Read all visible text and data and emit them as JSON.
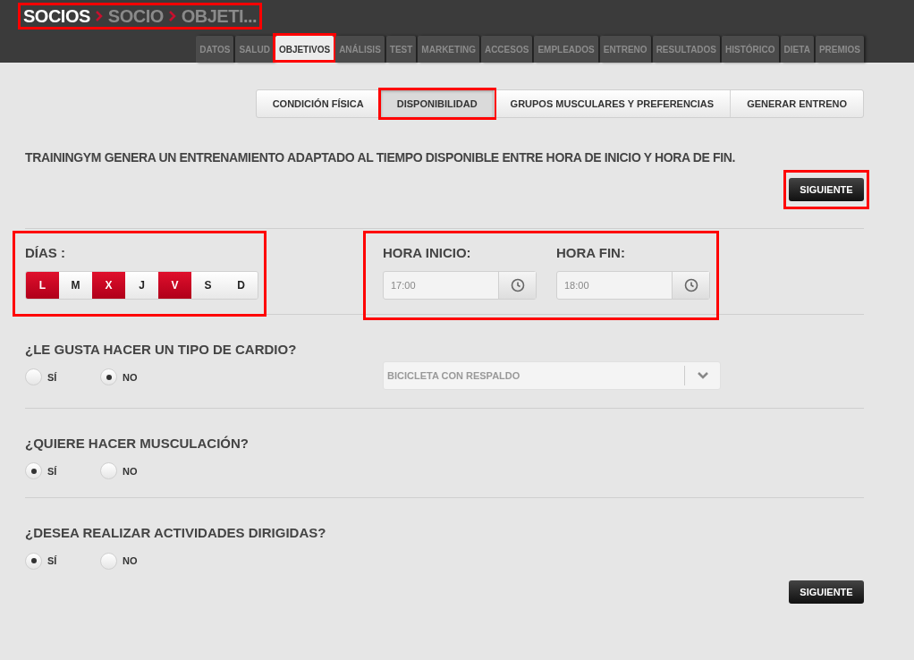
{
  "breadcrumb": {
    "highlight": true,
    "items": [
      {
        "label": "SOCIOS",
        "current": false
      },
      {
        "label": "SOCIO",
        "current": true
      },
      {
        "label": "OBJETI...",
        "current": true
      }
    ]
  },
  "tabs": [
    {
      "label": "DATOS",
      "selected": false,
      "highlight": false
    },
    {
      "label": "SALUD",
      "selected": false,
      "highlight": false
    },
    {
      "label": "OBJETIVOS",
      "selected": true,
      "highlight": true
    },
    {
      "label": "ANÁLISIS",
      "selected": false,
      "highlight": false
    },
    {
      "label": "TEST",
      "selected": false,
      "highlight": false
    },
    {
      "label": "MARKETING",
      "selected": false,
      "highlight": false
    },
    {
      "label": "ACCESOS",
      "selected": false,
      "highlight": false
    },
    {
      "label": "EMPLEADOS",
      "selected": false,
      "highlight": false
    },
    {
      "label": "ENTRENO",
      "selected": false,
      "highlight": false
    },
    {
      "label": "RESULTADOS",
      "selected": false,
      "highlight": false
    },
    {
      "label": "HISTÓRICO",
      "selected": false,
      "highlight": false
    },
    {
      "label": "DIETA",
      "selected": false,
      "highlight": false
    },
    {
      "label": "PREMIOS",
      "selected": false,
      "highlight": false
    }
  ],
  "subtabs": [
    {
      "label": "CONDICIÓN FÍSICA",
      "selected": false,
      "highlight": false
    },
    {
      "label": "DISPONIBILIDAD",
      "selected": true,
      "highlight": true
    },
    {
      "label": "GRUPOS MUSCULARES Y PREFERENCIAS",
      "selected": false,
      "highlight": false
    },
    {
      "label": "GENERAR ENTRENO",
      "selected": false,
      "highlight": false
    }
  ],
  "intro": "TRAININGYM GENERA UN ENTRENAMIENTO ADAPTADO AL TIEMPO DISPONIBLE ENTRE HORA DE INICIO Y HORA DE FIN.",
  "next_top": {
    "label": "SIGUIENTE",
    "highlight": true
  },
  "days": {
    "label": "DÍAS :",
    "highlight": true,
    "items": [
      {
        "label": "L",
        "selected": true
      },
      {
        "label": "M",
        "selected": false
      },
      {
        "label": "X",
        "selected": true
      },
      {
        "label": "J",
        "selected": false
      },
      {
        "label": "V",
        "selected": true
      },
      {
        "label": "S",
        "selected": false
      },
      {
        "label": "D",
        "selected": false
      }
    ]
  },
  "hours": {
    "highlight": true,
    "fields": [
      {
        "label": "HORA INICIO:",
        "value": "17:00"
      },
      {
        "label": "HORA FIN:",
        "value": "18:00"
      }
    ]
  },
  "questions": [
    {
      "question": "¿LE GUSTA HACER UN TIPO DE CARDIO?",
      "options": [
        {
          "label": "SÍ",
          "selected": false
        },
        {
          "label": "NO",
          "selected": true
        }
      ],
      "dropdown": {
        "value": "BICICLETA CON RESPALDO"
      }
    },
    {
      "question": "¿QUIERE HACER MUSCULACIÓN?",
      "options": [
        {
          "label": "SÍ",
          "selected": true
        },
        {
          "label": "NO",
          "selected": false
        }
      ]
    },
    {
      "question": "¿DESEA REALIZAR ACTIVIDADES DIRIGIDAS?",
      "options": [
        {
          "label": "SÍ",
          "selected": true
        },
        {
          "label": "NO",
          "selected": false
        }
      ]
    }
  ],
  "next_bottom": {
    "label": "SIGUIENTE"
  }
}
